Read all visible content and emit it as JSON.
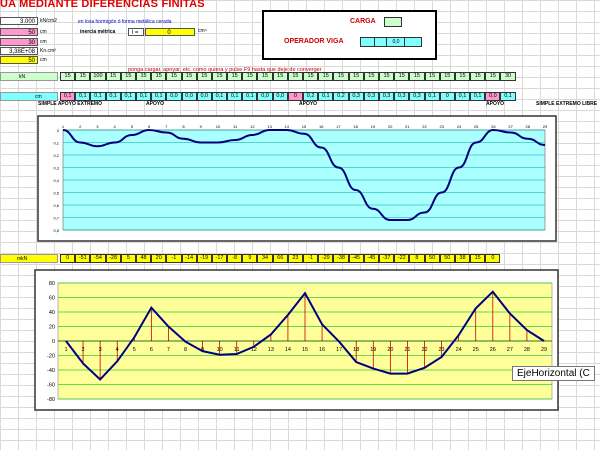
{
  "title": "UA MEDIANTE DIFERENCIAS FINITAS",
  "params": {
    "e_value": "3.000",
    "e_unit": "kN/cm2",
    "note": "en losa hormigón ó forma metálica cerada",
    "v1": "50",
    "v1_unit": "cm",
    "inercia_label": "inercia métrica",
    "inercia_sym": "I =",
    "inercia_val": "0",
    "inercia_unit": "cm⁴",
    "v2": "30",
    "v2_unit": "cm",
    "ei": "3,38E+08",
    "ei_unit": "Kn.cm²",
    "v3": "50",
    "v3_unit": "cm"
  },
  "panel": {
    "carga_label": "CARGA",
    "operador_label": "OPERADOR VIGA",
    "operador_val": "0,0"
  },
  "row_units": {
    "kn": "kN",
    "cm": "cm",
    "knm": "mkN"
  },
  "row_loads": [
    "15",
    "15",
    "100",
    "15",
    "15",
    "15",
    "15",
    "15",
    "15",
    "15",
    "15",
    "15",
    "15",
    "15",
    "15",
    "15",
    "15",
    "15",
    "15",
    "15",
    "15",
    "15",
    "15",
    "15",
    "15",
    "15",
    "15",
    "15",
    "15",
    "30"
  ],
  "row_defl": [
    "0,1",
    "0,1",
    "0,1",
    "0,1",
    "0,1",
    "0,1",
    "0,1",
    "0,0",
    "0,0",
    "0,0",
    "0,1",
    "0,1",
    "0,1",
    "0,0",
    "0,0",
    "0",
    "0,2",
    "0,1",
    "0,2",
    "0,3",
    "0,3",
    "0,3",
    "0,3",
    "0,3",
    "0,1",
    "0",
    "0,1",
    "0,1",
    "0,0",
    "0,1"
  ],
  "support_labels": [
    "SIMPLE APOYO EXTREMO",
    "APOYO",
    "APOYO",
    "APOYO",
    "SIMPLE EXTREMO LIBRE"
  ],
  "instruction": "ponga cargar, apoyar, etc. como quiera y pulse F9 hasta que deje de converger",
  "row_moments": [
    "0",
    "-51",
    "-54",
    "-28",
    "5",
    "48",
    "20",
    "-1",
    "-14",
    "-19",
    "-17",
    "-8",
    "9",
    "34",
    "66",
    "23",
    "-1",
    "-29",
    "-38",
    "-45",
    "-45",
    "-37",
    "-22",
    "8",
    "50",
    "50",
    "38",
    "15",
    "0"
  ],
  "chart_defl": {
    "type": "line",
    "x": [
      1,
      2,
      3,
      4,
      5,
      6,
      7,
      8,
      9,
      10,
      11,
      12,
      13,
      14,
      15,
      16,
      17,
      18,
      19,
      20,
      21,
      22,
      23,
      24,
      25,
      26,
      27,
      28,
      29
    ],
    "values": [
      0,
      0.1,
      0.13,
      0.1,
      0.04,
      0,
      0.02,
      0.07,
      0.1,
      0.1,
      0.08,
      0.04,
      0,
      0,
      0.03,
      0.14,
      0.3,
      0.48,
      0.63,
      0.72,
      0.72,
      0.66,
      0.5,
      0.3,
      0.1,
      0,
      0.02,
      0.07,
      0.12
    ],
    "ylim": [
      0,
      0.8
    ],
    "ticks": [
      "0",
      "0,1",
      "0,2",
      "0,3",
      "0,4",
      "0,5",
      "0,6",
      "0,7",
      "0,8"
    ]
  },
  "chart_moment": {
    "type": "line",
    "x": [
      1,
      2,
      3,
      4,
      5,
      6,
      7,
      8,
      9,
      10,
      11,
      12,
      13,
      14,
      15,
      16,
      17,
      18,
      19,
      20,
      21,
      22,
      23,
      24,
      25,
      26,
      27,
      28,
      29
    ],
    "values": [
      0,
      -31,
      -53,
      -28,
      5,
      46,
      20,
      -1,
      -14,
      -19,
      -18,
      -8,
      9,
      36,
      66,
      23,
      -1,
      -29,
      -38,
      -45,
      -45,
      -37,
      -22,
      8,
      45,
      68,
      38,
      15,
      0
    ],
    "ylim": [
      -80,
      80
    ],
    "yticks": [
      "80",
      "60",
      "40",
      "20",
      "0",
      "-20",
      "-40",
      "-60",
      "-80"
    ]
  },
  "tooltip": "EjeHorizontal (C"
}
